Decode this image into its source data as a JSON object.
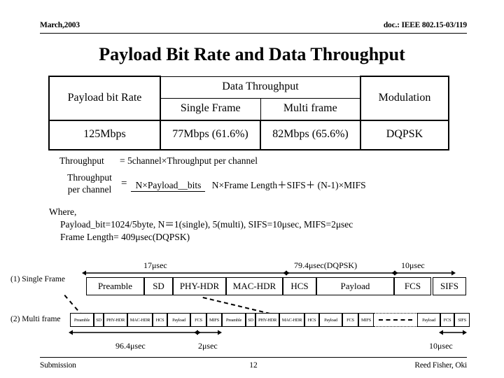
{
  "header": {
    "date": "March,2003",
    "doc": "doc.: IEEE 802.15-03/119"
  },
  "title": "Payload Bit Rate and Data Throughput",
  "table": {
    "col_payload_bit_rate": "Payload bit Rate",
    "col_data_throughput": "Data Throughput",
    "col_single_frame": "Single Frame",
    "col_multi_frame": "Multi frame",
    "col_modulation": "Modulation",
    "row": {
      "payload_bit_rate": "125Mbps",
      "single_frame": "77Mbps (61.6%)",
      "multi_frame": "82Mbps (65.6%)",
      "modulation": "DQPSK"
    }
  },
  "formulas": {
    "line1_label": "Throughput",
    "line1_value": "= 5channel×Throughput per channel",
    "frac_label_top": "Throughput",
    "frac_label_bottom": "per channel",
    "equals": "=",
    "numerator": "N×Payload__bits",
    "denominator": "N×Frame Length＋SIFS＋ (N-1)×MIFS",
    "where": "Where,",
    "where_line1": "Payload_bit=1024/5byte, N＝1(single), 5(multi), SIFS=10μsec, MIFS=2μsec",
    "where_line2": "Frame Length= 409μsec(DQPSK)"
  },
  "diagram": {
    "label_single": "(1) Single Frame",
    "label_multi": "(2) Multi frame",
    "dims_single": {
      "d1": "17μsec",
      "d2": "79.4μsec(DQPSK)",
      "d3": "10μsec"
    },
    "dims_multi": {
      "d1": "96.4μsec",
      "d2": "2μsec",
      "d3": "10μsec"
    },
    "single_frame_cells": [
      "Preamble",
      "SD",
      "PHY-HDR",
      "MAC-HDR",
      "HCS",
      "Payload",
      "FCS",
      "SIFS"
    ],
    "multi_frame_cells": [
      "Preamble",
      "SD",
      "PHY-HDR",
      "MAC-HDR",
      "HCS",
      "Payload",
      "FCS",
      "MIFS",
      "Preamble",
      "SD",
      "PHY-HDR",
      "MAC-HDR",
      "HCS",
      "Payload",
      "FCS",
      "MIFS",
      "",
      "Payload",
      "FCS",
      "SIFS"
    ]
  },
  "footer": {
    "left": "Submission",
    "center": "12",
    "right": "Reed Fisher, Oki"
  }
}
